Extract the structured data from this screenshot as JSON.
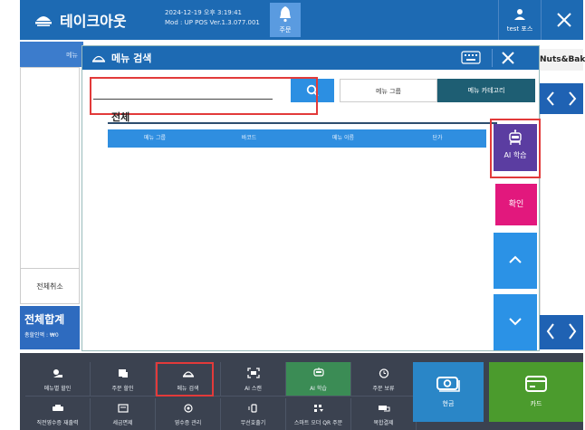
{
  "header": {
    "app_title": "테이크아웃",
    "datetime": "2024-12-19 오후 3:19:41",
    "version": "Mod : UP POS Ver.1.3.077.001",
    "order_bell_label": "주문",
    "user_label": "test 포스",
    "icons": [
      "logo-icon",
      "bell-icon",
      "user-icon",
      "close-icon"
    ]
  },
  "left_panel": {
    "tab_label": "메뉴",
    "cancel_all": "전체취소",
    "total_title": "전체합계",
    "total_sub": "총할인액 : ₩0"
  },
  "right_panel": {
    "category_tab": "Nuts&Bakes"
  },
  "modal": {
    "title": "메뉴 검색",
    "search_value": "",
    "segments": {
      "group": "메뉴 그룹",
      "category": "메뉴 카테고리"
    },
    "all_label": "전체",
    "columns": [
      "메뉴 그룹",
      "바코드",
      "메뉴 이름",
      "단가"
    ],
    "rows": [],
    "ai_learn_label": "AI 학습",
    "confirm_label": "확인",
    "selected_segment": "메뉴 카테고리"
  },
  "bottom": {
    "row1": [
      "메뉴별 할인",
      "주문 할인",
      "메뉴 검색",
      "AI 스캔",
      "AI 학습",
      "주문 보류"
    ],
    "row2": [
      "직전영수증 재출력",
      "세금면제",
      "영수증 관리",
      "무선호출기",
      "스마트 오더 QR 주문",
      "복합결제"
    ],
    "cash_label": "현금",
    "card_label": "카드"
  },
  "colors": {
    "primary_blue": "#1d6ab3",
    "accent_blue": "#2b92e6",
    "ai_purple": "#5b3da1",
    "confirm_pink": "#e2187d",
    "card_green": "#4b9b2d",
    "highlight_red": "#e23a3a"
  }
}
